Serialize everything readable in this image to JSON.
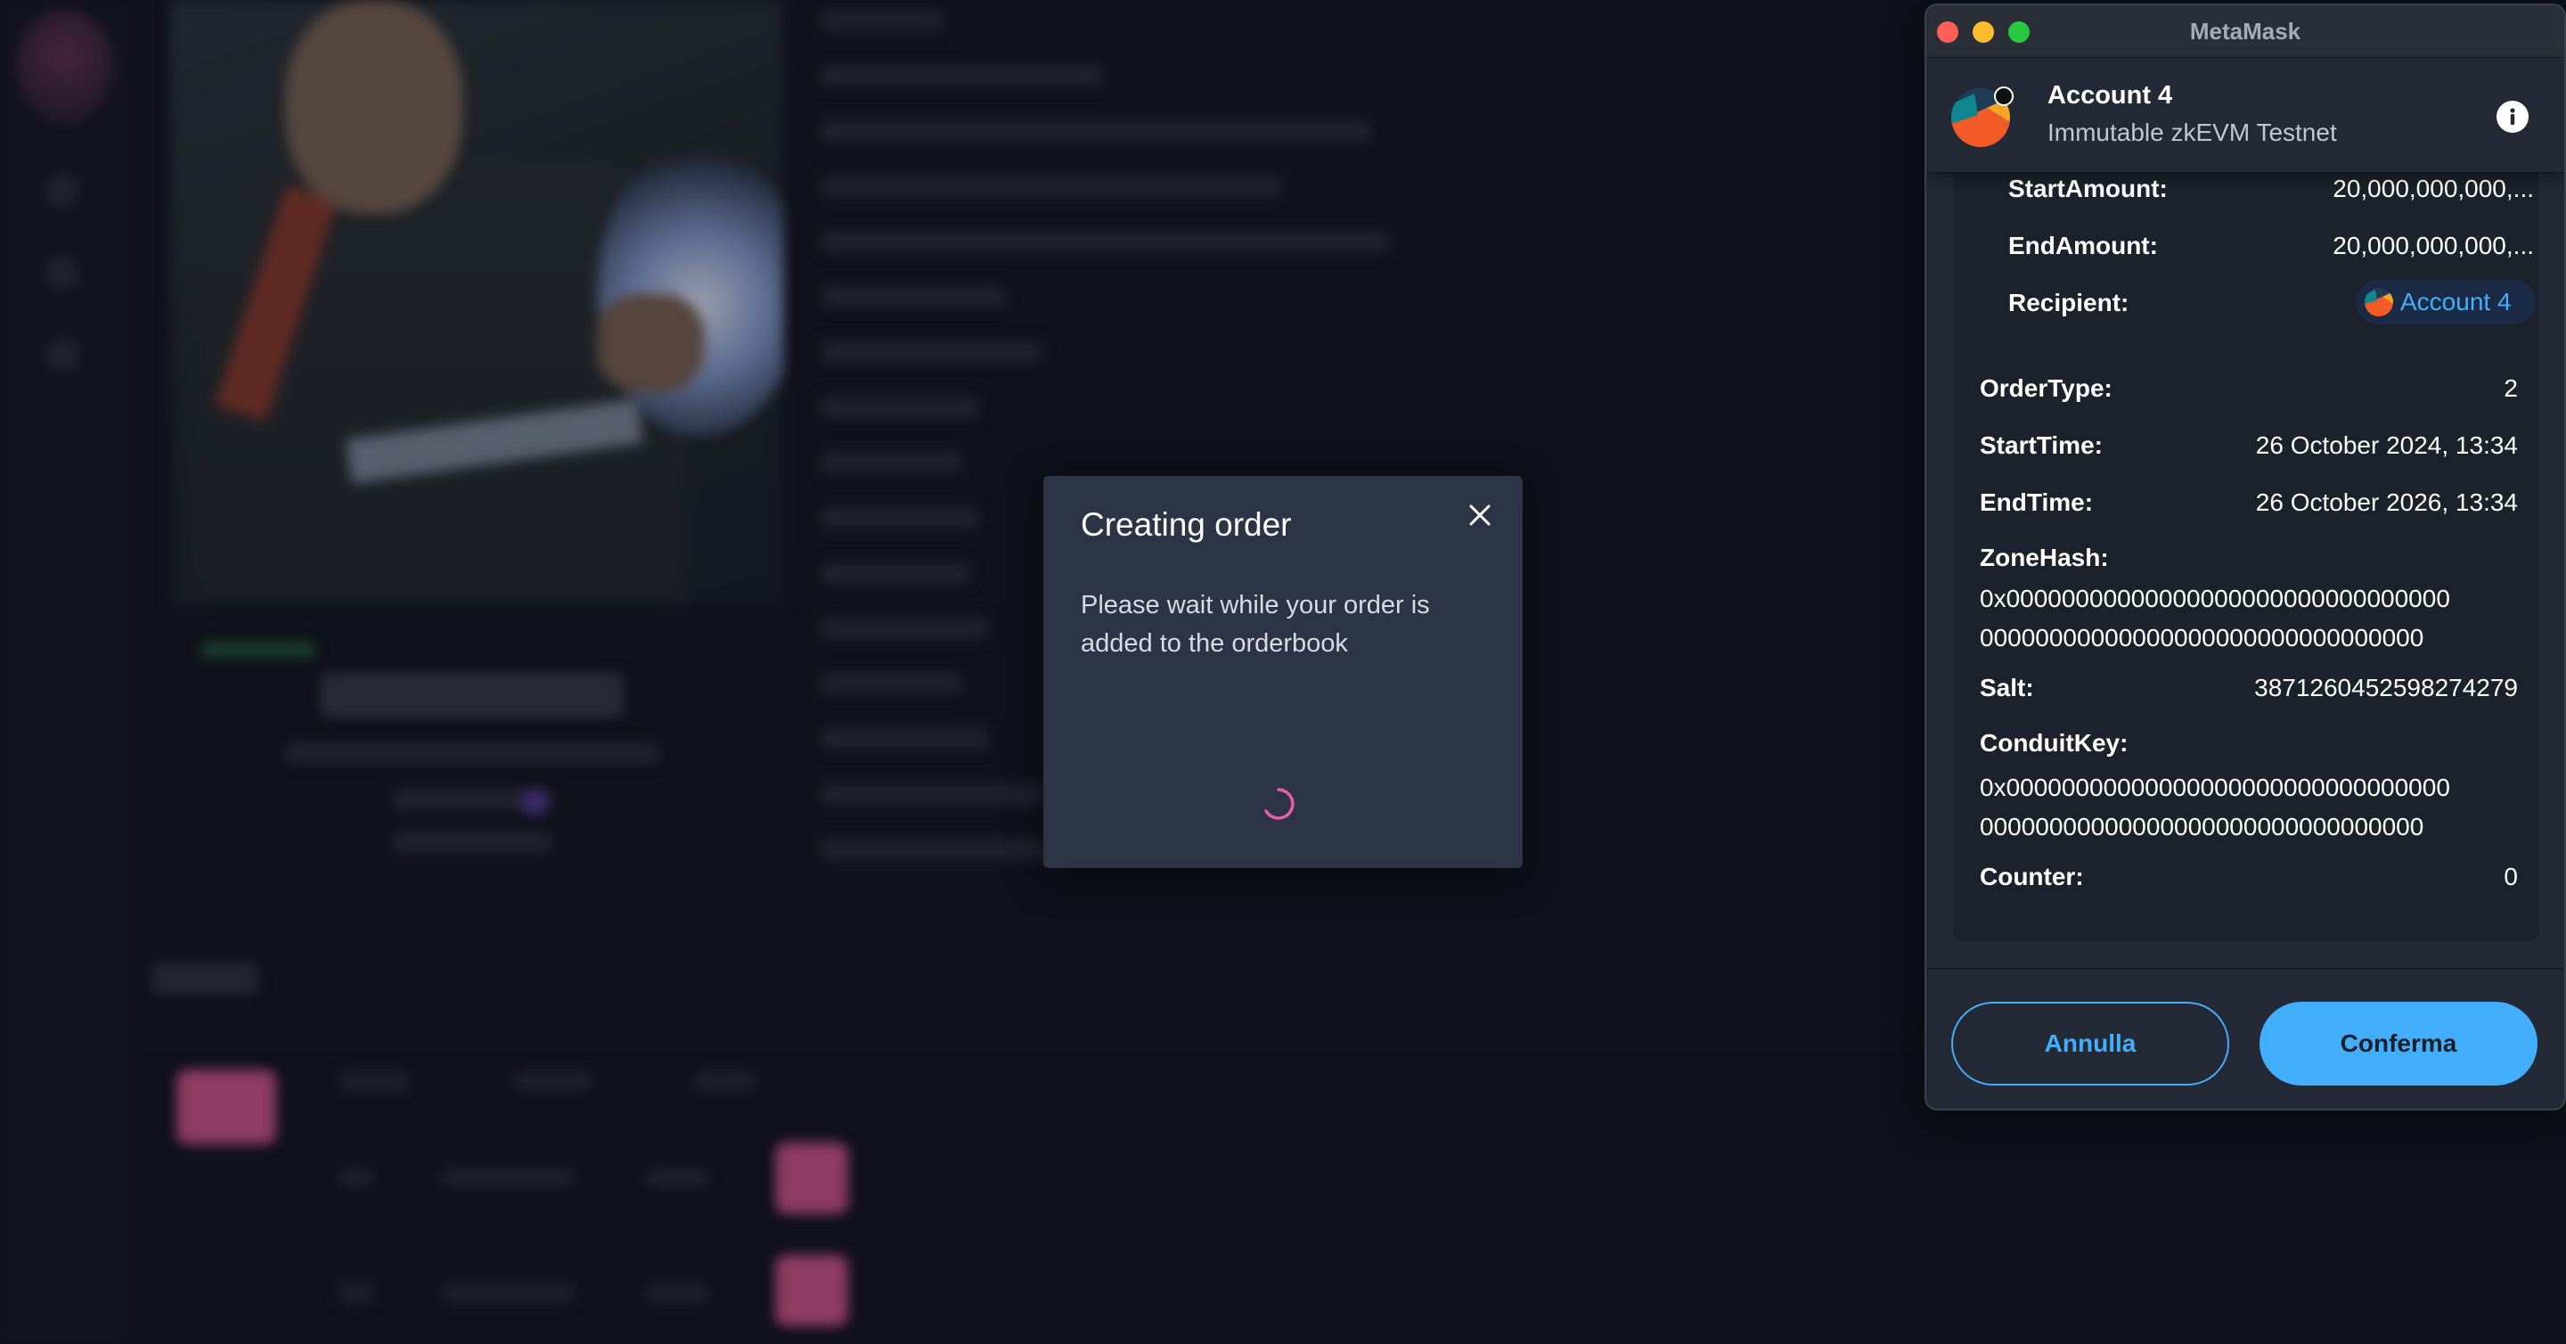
{
  "modal": {
    "title": "Creating order",
    "message": "Please wait while your order is added to the orderbook",
    "close_icon": "close-icon",
    "spinner_color": "#e45fa8"
  },
  "metamask": {
    "window_title": "MetaMask",
    "account_name": "Account 4",
    "network": "Immutable zkEVM Testnet",
    "accent_color": "#43aefc",
    "fields": {
      "start_amount": {
        "label": "StartAmount:",
        "value": "20,000,000,000,..."
      },
      "end_amount": {
        "label": "EndAmount:",
        "value": "20,000,000,000,..."
      },
      "recipient": {
        "label": "Recipient:",
        "value": "Account 4"
      },
      "order_type": {
        "label": "OrderType:",
        "value": "2"
      },
      "start_time": {
        "label": "StartTime:",
        "value": "26 October 2024, 13:34"
      },
      "end_time": {
        "label": "EndTime:",
        "value": "26 October 2026, 13:34"
      },
      "zone_hash": {
        "label": "ZoneHash:",
        "line1": "0x00000000000000000000000000000000",
        "line2": "00000000000000000000000000000000"
      },
      "salt": {
        "label": "Salt:",
        "value": "3871260452598274279"
      },
      "conduit_key": {
        "label": "ConduitKey:",
        "line1": "0x00000000000000000000000000000000",
        "line2": "00000000000000000000000000000000"
      },
      "counter": {
        "label": "Counter:",
        "value": "0"
      }
    },
    "buttons": {
      "cancel": "Annulla",
      "confirm": "Conferma"
    }
  }
}
